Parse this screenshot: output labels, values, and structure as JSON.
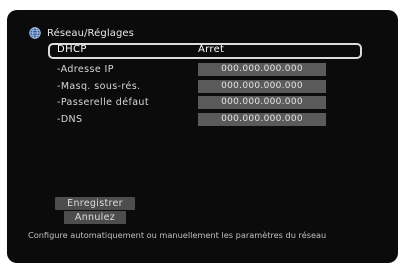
{
  "header": {
    "icon": "globe-icon",
    "title": "Réseau/Réglages"
  },
  "rows": [
    {
      "label": "DHCP",
      "value": "Arret",
      "selected": true
    },
    {
      "label": "-Adresse IP",
      "value": "000.000.000.000"
    },
    {
      "label": "-Masq. sous-rés.",
      "value": "000.000.000.000"
    },
    {
      "label": "-Passerelle défaut",
      "value": "000.000.000.000"
    },
    {
      "label": "-DNS",
      "value": "000.000.000.000"
    }
  ],
  "buttons": {
    "save": "Enregistrer",
    "cancel": "Annulez"
  },
  "hint": "Configure automatiquement ou manuellement les paramètres du réseau",
  "colors": {
    "screen_background": "#0b0b0b",
    "value_field": "#5a5a5a",
    "button": "#4d4d4d",
    "text": "#e8e8e8"
  }
}
